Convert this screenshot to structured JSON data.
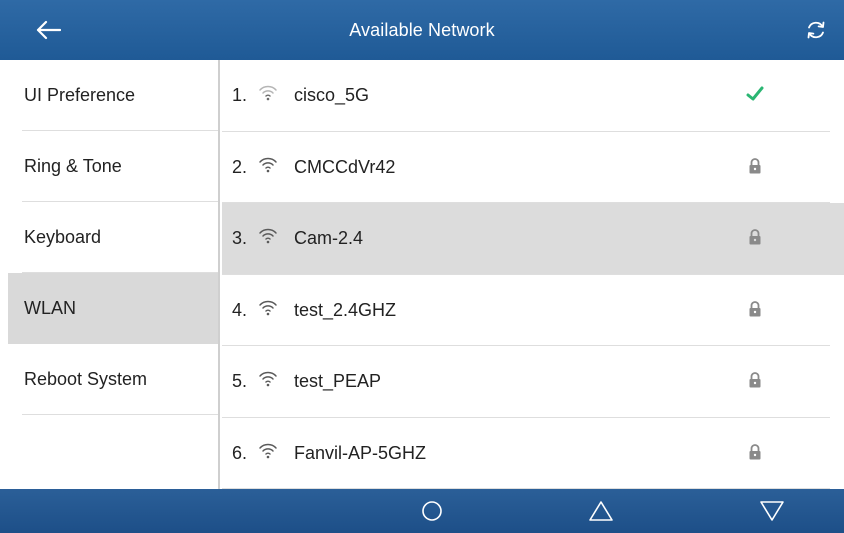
{
  "header": {
    "title": "Available Network",
    "back_icon": "arrow-left-icon",
    "refresh_icon": "refresh-icon"
  },
  "sidebar": {
    "items": [
      {
        "label": "UI Preference",
        "active": false
      },
      {
        "label": "Ring & Tone",
        "active": false
      },
      {
        "label": "Keyboard",
        "active": false
      },
      {
        "label": "WLAN",
        "active": true
      },
      {
        "label": "Reboot System",
        "active": false
      }
    ]
  },
  "networks": [
    {
      "index": "1.",
      "ssid": "cisco_5G",
      "status": "connected",
      "status_icon": "checkmark-icon"
    },
    {
      "index": "2.",
      "ssid": "CMCCdVr42",
      "status": "secured",
      "status_icon": "lock-icon"
    },
    {
      "index": "3.",
      "ssid": "Cam-2.4",
      "status": "secured",
      "status_icon": "lock-icon",
      "selected": true
    },
    {
      "index": "4.",
      "ssid": "test_2.4GHZ",
      "status": "secured",
      "status_icon": "lock-icon"
    },
    {
      "index": "5.",
      "ssid": "test_PEAP",
      "status": "secured",
      "status_icon": "lock-icon"
    },
    {
      "index": "6.",
      "ssid": "Fanvil-AP-5GHZ",
      "status": "secured",
      "status_icon": "lock-icon"
    }
  ],
  "navbar": {
    "buttons": [
      "home-circle-icon",
      "up-triangle-icon",
      "down-triangle-icon"
    ]
  },
  "colors": {
    "header_bg": "#2f6aa6",
    "navbar_bg": "#1d4f88",
    "selected_bg": "#d9d9d9",
    "check_green": "#2bb673",
    "lock_gray": "#8a8a8a"
  }
}
